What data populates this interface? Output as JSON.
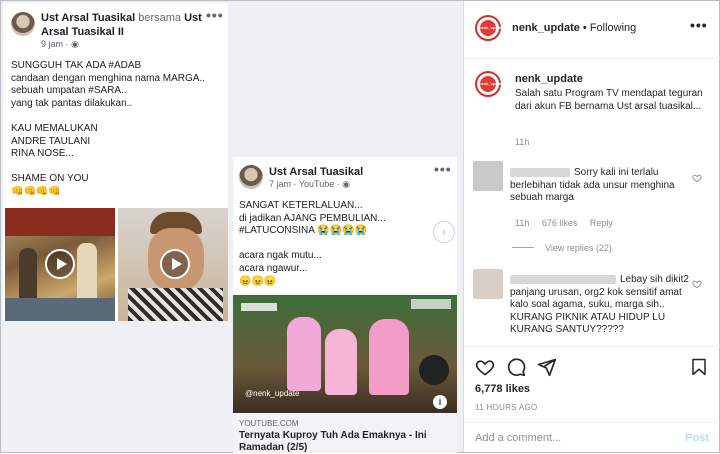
{
  "fb_post1": {
    "author": "Ust Arsal Tuasikal",
    "with_word": "bersama",
    "tagged": "Ust Arsal Tuasikal II",
    "time": "9 jam · ",
    "body": "SUNGGUH TAK ADA #ADAB\ncandaan dengan menghina nama MARGA..\nsebuah umpatan #SARA..\nyang tak pantas dilakukan..\n\nKAU MEMALUKAN\nANDRE TAULANI\nRINA NOSE...\n\nSHAME ON YOU\n👊👊👊👊",
    "more": "•••"
  },
  "fb_post2": {
    "author": "Ust Arsal Tuasikal",
    "time": "7 jam · YouTube · ",
    "body": "SANGAT KETERLALUAN...\ndi jadikan AJANG PEMBULIAN...\n#LATUCONSINA 😭😭😭😭\n\nacara ngak mutu...\nacara ngawur...\n😠😠😠",
    "more": "•••",
    "watermark_user": "@nenk_update",
    "link_domain": "YOUTUBE.COM",
    "link_title": "Ternyata Kuproy Tuh Ada Emaknya - Ini Ramadan (2/5)",
    "info_icon": "i"
  },
  "ig": {
    "username": "nenk_update",
    "following": "• Following",
    "more": "•••",
    "logo_text": "nenk_update",
    "caption_user": "nenk_update",
    "caption": "Salah satu Program TV mendapat teguran dari akun FB bernama Ust arsal tuasikal...",
    "caption_time": "11h",
    "comment1": "Sorry kali ini terlalu berlebihan tidak ada unsur menghina sebuah marga",
    "comment1_time": "11h",
    "comment1_likes": "676 likes",
    "reply": "Reply",
    "view_replies": "View replies (22)",
    "comment2": "Lebay sih dikit2 panjang urusan, org2 kok sensitif amat kalo soal agama, suku, marga sih.. KURANG PIKNIK ATAU HIDUP LU KURANG SANTUY?????",
    "likes": "6,778 likes",
    "date": "11 HOURS AGO",
    "add_comment_placeholder": "Add a comment...",
    "post_label": "Post",
    "colors": {
      "accent": "#0095f6",
      "logo_red": "#e53935"
    }
  }
}
